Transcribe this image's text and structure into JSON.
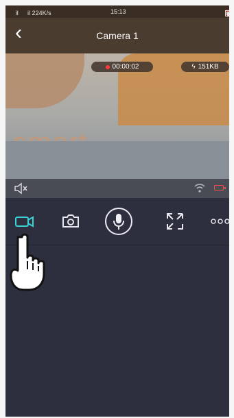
{
  "status_bar": {
    "signal_text": "ᅟ il ᅟ il 224K/s",
    "time": "15:13"
  },
  "header": {
    "title": "Camera 1"
  },
  "video": {
    "overlay_word": "smart",
    "recording_time": "00:00:02",
    "data_size": "151KB"
  },
  "icons": {
    "wifi": "wifi-icon",
    "alarm": "alarm-icon",
    "battery": "battery-icon",
    "back": "chevron-left-icon",
    "mute": "speaker-muted-icon",
    "record": "video-camera-icon",
    "snapshot": "camera-icon",
    "mic": "microphone-icon",
    "fullscreen": "expand-icon",
    "more": "more-icon",
    "hand": "pointing-hand-icon"
  },
  "colors": {
    "accent": "#38d3d5",
    "low_battery": "#ff4a4a",
    "recording": "#ff3a3a"
  }
}
